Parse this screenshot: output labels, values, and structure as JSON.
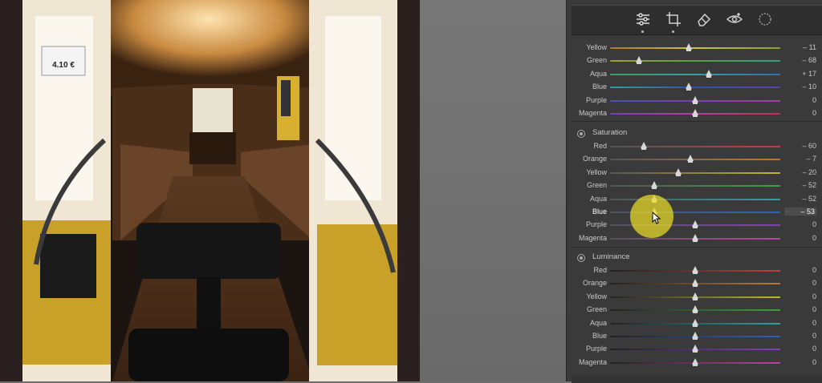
{
  "hue_rows": [
    {
      "label": "Yellow",
      "value": "– 11",
      "pos": 0.46,
      "color": "linear-gradient(90deg,#b07a2a,#c9c040,#8aa030)"
    },
    {
      "label": "Green",
      "value": "– 68",
      "pos": 0.17,
      "color": "linear-gradient(90deg,#a0a030,#55a040,#2ea080)"
    },
    {
      "label": "Aqua",
      "value": "+ 17",
      "pos": 0.58,
      "color": "linear-gradient(90deg,#3aa060,#30a0a0,#3070b0)"
    },
    {
      "label": "Blue",
      "value": "– 10",
      "pos": 0.46,
      "color": "linear-gradient(90deg,#30a0a0,#3050b0,#6040b0)"
    },
    {
      "label": "Purple",
      "value": "0",
      "pos": 0.5,
      "color": "linear-gradient(90deg,#4a50b0,#7a40b0,#a040a0)"
    },
    {
      "label": "Magenta",
      "value": "0",
      "pos": 0.5,
      "color": "linear-gradient(90deg,#7a40b0,#b040a0,#c03050)"
    }
  ],
  "saturation": {
    "title": "Saturation",
    "rows": [
      {
        "label": "Red",
        "value": "– 60",
        "pos": 0.2,
        "color": "linear-gradient(90deg,#555,#c04040)"
      },
      {
        "label": "Orange",
        "value": "– 7",
        "pos": 0.47,
        "color": "linear-gradient(90deg,#555,#c07a30)"
      },
      {
        "label": "Yellow",
        "value": "– 20",
        "pos": 0.4,
        "color": "linear-gradient(90deg,#555,#c0b830)"
      },
      {
        "label": "Green",
        "value": "– 52",
        "pos": 0.26,
        "color": "linear-gradient(90deg,#555,#40a040)"
      },
      {
        "label": "Aqua",
        "value": "– 52",
        "pos": 0.26,
        "color": "linear-gradient(90deg,#555,#30a0a0)"
      },
      {
        "label": "Blue",
        "value": "– 53",
        "pos": 0.26,
        "color": "linear-gradient(90deg,#555,#3060c0)",
        "active": true
      },
      {
        "label": "Purple",
        "value": "0",
        "pos": 0.5,
        "color": "linear-gradient(90deg,#555,#8040c0)"
      },
      {
        "label": "Magenta",
        "value": "0",
        "pos": 0.5,
        "color": "linear-gradient(90deg,#555,#c040a0)"
      }
    ]
  },
  "luminance": {
    "title": "Luminance",
    "rows": [
      {
        "label": "Red",
        "value": "0",
        "pos": 0.5,
        "color": "linear-gradient(90deg,#222,#c04040)"
      },
      {
        "label": "Orange",
        "value": "0",
        "pos": 0.5,
        "color": "linear-gradient(90deg,#222,#c07a30)"
      },
      {
        "label": "Yellow",
        "value": "0",
        "pos": 0.5,
        "color": "linear-gradient(90deg,#222,#c0b830)"
      },
      {
        "label": "Green",
        "value": "0",
        "pos": 0.5,
        "color": "linear-gradient(90deg,#222,#40a040)"
      },
      {
        "label": "Aqua",
        "value": "0",
        "pos": 0.5,
        "color": "linear-gradient(90deg,#222,#30a0a0)"
      },
      {
        "label": "Blue",
        "value": "0",
        "pos": 0.5,
        "color": "linear-gradient(90deg,#222,#3060c0)"
      },
      {
        "label": "Purple",
        "value": "0",
        "pos": 0.5,
        "color": "linear-gradient(90deg,#222,#8040c0)"
      },
      {
        "label": "Magenta",
        "value": "0",
        "pos": 0.5,
        "color": "linear-gradient(90deg,#222,#c040a0)"
      }
    ]
  },
  "photo": {
    "price_sign": "4.10 €"
  },
  "toolbar": {
    "tools": [
      {
        "icon": "edit-sliders-icon",
        "active": true
      },
      {
        "icon": "crop-icon",
        "active": false
      },
      {
        "icon": "eraser-icon",
        "active": false
      },
      {
        "icon": "red-eye-icon",
        "active": false
      },
      {
        "icon": "mask-icon",
        "active": false
      }
    ]
  }
}
